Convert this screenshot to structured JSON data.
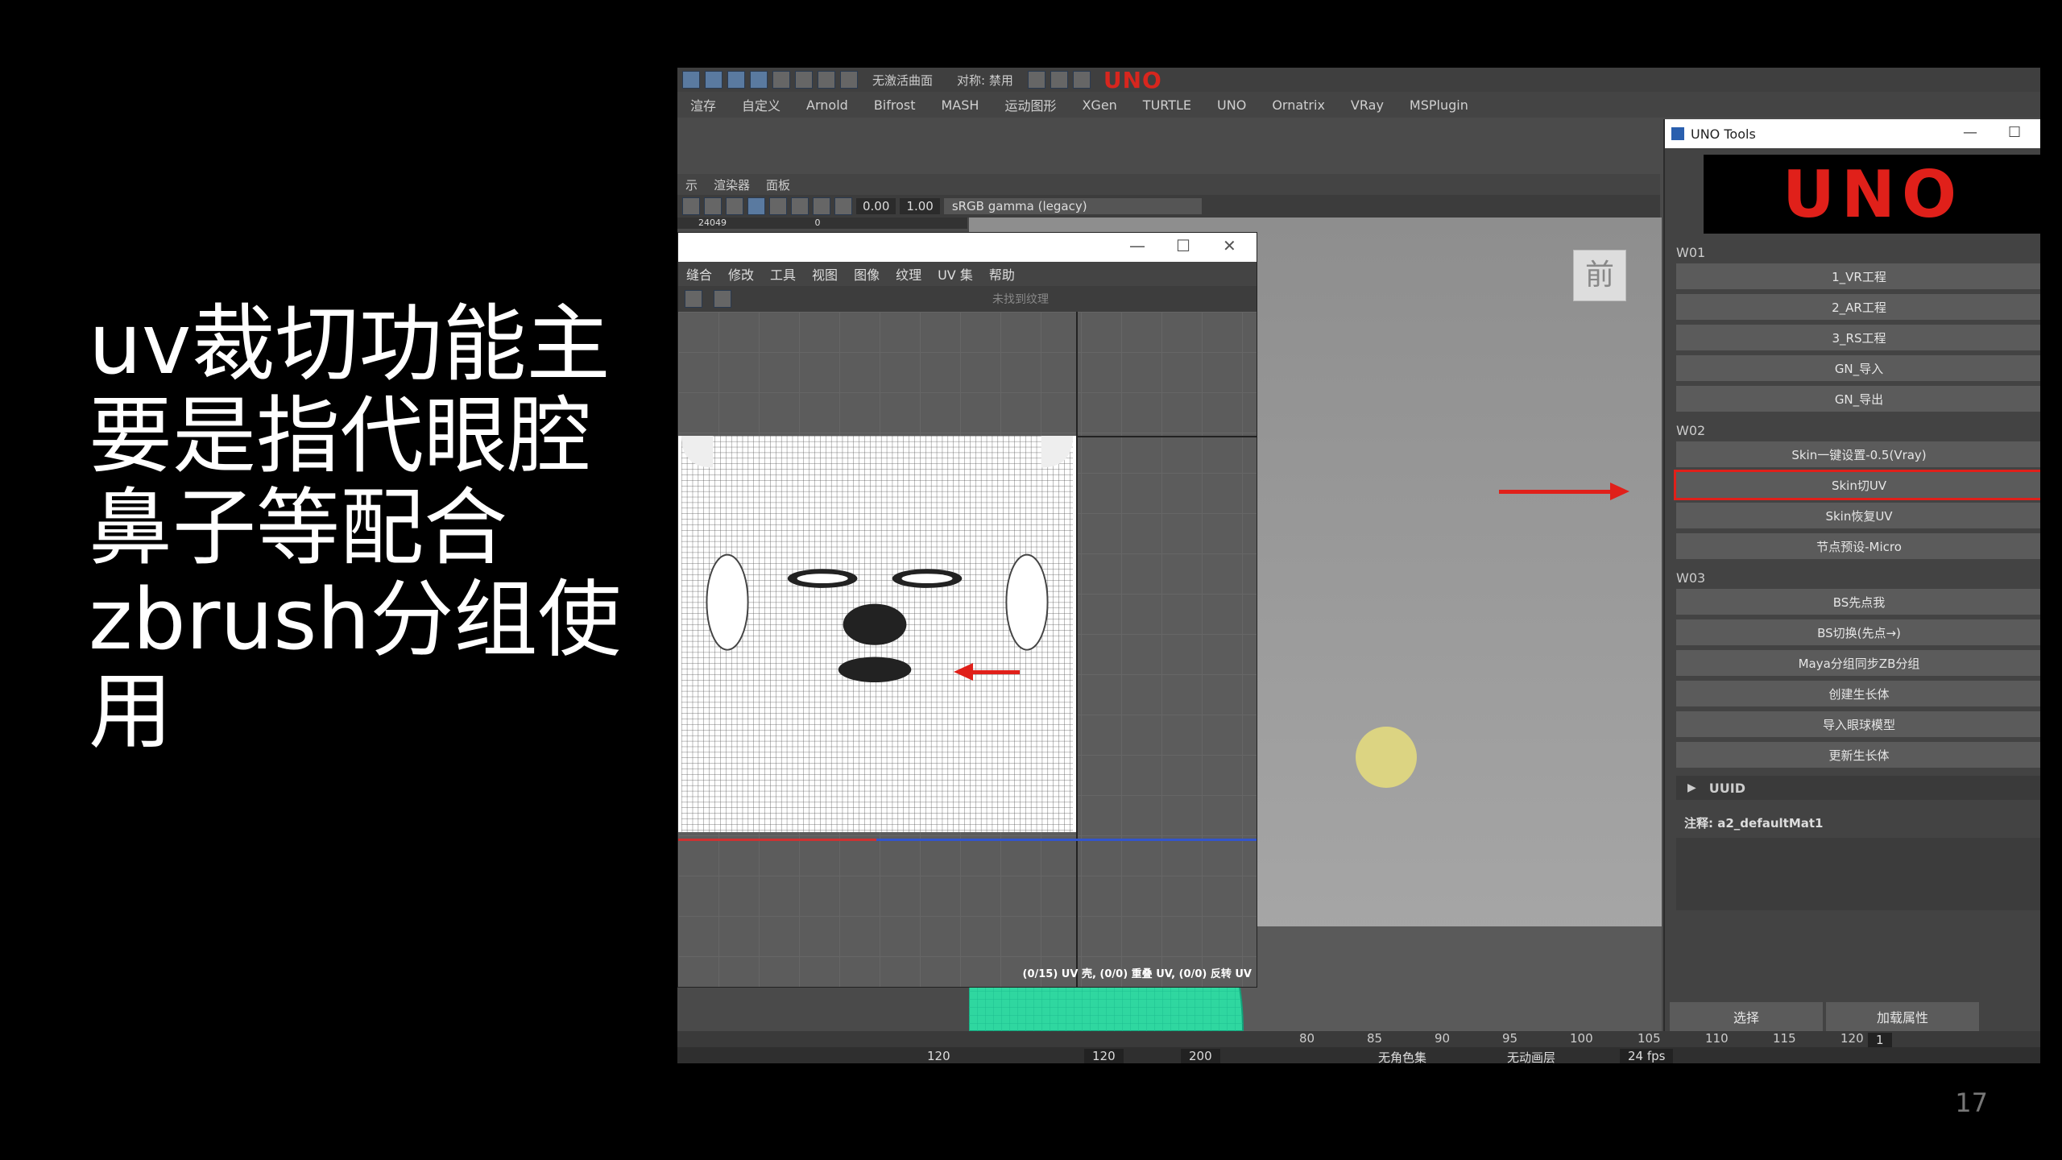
{
  "slide": {
    "text": "uv裁切功能主要是指代眼腔鼻子等配合zbrush分组使用",
    "page_number": "17"
  },
  "maya": {
    "toolbar": {
      "field_curve": "无激活曲面",
      "field_symmetry": "对称: 禁用",
      "uno_label": "UNO"
    },
    "shelf_tabs": [
      "渲存",
      "自定义",
      "Arnold",
      "Bifrost",
      "MASH",
      "运动图形",
      "XGen",
      "TURTLE",
      "UNO",
      "Ornatrix",
      "VRay",
      "MSPlugin"
    ],
    "viewport_menu": [
      "示",
      "渲染器",
      "面板"
    ],
    "viewport_tools": {
      "value_a": "0.00",
      "value_b": "1.00",
      "color_space": "sRGB gamma (legacy)",
      "sub_a": "24049",
      "sub_b": "0"
    },
    "view_cube_label": "前",
    "uv_editor": {
      "menu": [
        "缝合",
        "修改",
        "工具",
        "视图",
        "图像",
        "纹理",
        "UV 集",
        "帮助"
      ],
      "texture_field": "未找到纹理",
      "status": "(0/15) UV 壳, (0/0) 重叠 UV, (0/0) 反转 UV"
    },
    "uno_tools": {
      "title": "UNO Tools",
      "logo": "UNO",
      "groups": [
        {
          "label": "W01",
          "buttons": [
            "1_VR工程",
            "2_AR工程",
            "3_RS工程",
            "GN_导入",
            "GN_导出"
          ]
        },
        {
          "label": "W02",
          "buttons": [
            "Skin一键设置-0.5(Vray)",
            "Skin切UV",
            "Skin恢复UV",
            "节点预设-Micro"
          ]
        },
        {
          "label": "W03",
          "buttons": [
            "BS先点我",
            "BS切换(先点→)",
            "Maya分组同步ZB分组",
            "创建生长体",
            "导入眼球模型",
            "更新生长体"
          ]
        }
      ],
      "highlighted_button": "Skin切UV",
      "uuid_label": "UUID",
      "note": "注释:  a2_defaultMat1",
      "bottom_buttons": [
        "选择",
        "加载属性"
      ]
    },
    "timeline": {
      "ticks": [
        "80",
        "85",
        "90",
        "95",
        "100",
        "105",
        "110",
        "115",
        "120"
      ],
      "current_frame": "1",
      "range_end_a": "120",
      "range_end_b": "120",
      "range_end_c": "200",
      "char_set": "无角色集",
      "anim_layer": "无动画层",
      "fps": "24 fps"
    }
  }
}
